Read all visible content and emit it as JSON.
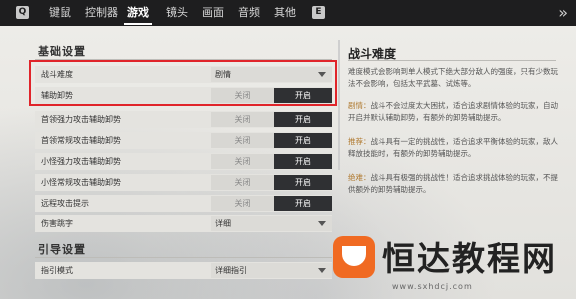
{
  "topbar": {
    "left_icon": "Q",
    "tabs": [
      {
        "label": "键鼠",
        "active": false
      },
      {
        "label": "控制器",
        "active": false
      },
      {
        "label": "游戏",
        "active": true
      },
      {
        "label": "镜头",
        "active": false
      },
      {
        "label": "画面",
        "active": false
      },
      {
        "label": "音频",
        "active": false
      },
      {
        "label": "其他",
        "active": false
      }
    ],
    "right_icon": "E",
    "close_icon": "chevron-right-double-icon"
  },
  "sections": {
    "basic": "基础设置",
    "guide": "引导设置"
  },
  "options": {
    "off": "关闭",
    "on": "开启"
  },
  "rows": {
    "difficulty": {
      "label": "战斗难度",
      "value": "剧情"
    },
    "assist_lock": {
      "label": "辅助卸势"
    },
    "chief_strong": {
      "label": "首领强力攻击辅助卸势"
    },
    "chief_normal": {
      "label": "首领常规攻击辅助卸势"
    },
    "minion_strong": {
      "label": "小怪强力攻击辅助卸势"
    },
    "minion_normal": {
      "label": "小怪常规攻击辅助卸势"
    },
    "ranged_hint": {
      "label": "远程攻击提示"
    },
    "damage_jump": {
      "label": "伤害跳字",
      "value": "详细"
    },
    "guide_mode": {
      "label": "指引模式",
      "value": "详细指引"
    }
  },
  "panel": {
    "title": "战斗难度",
    "intro": "难度模式会影响到单人模式下绝大部分敌人的强度，只有少数玩法不会影响，包括太平武墓、试炼等。",
    "entries": [
      {
        "tag": "剧情：",
        "text": "战斗不会过度太大困扰，适合追求剧情体验的玩家，自动开启并默认辅助卸势，有额外的卸势辅助提示。"
      },
      {
        "tag": "推荐：",
        "text": "战斗具有一定的挑战性，适合追求平衡体验的玩家，敌人释放技能时，有额外的卸势辅助提示。"
      },
      {
        "tag": "绝难：",
        "text": "战斗具有极强的挑战性！适合追求挑战体验的玩家，不提供额外的卸势辅助提示。"
      }
    ]
  },
  "watermark": {
    "text": "恒达教程网",
    "url": "www.sxhdcj.com"
  },
  "colors": {
    "highlight": "#e0242a",
    "active_option": "#2f3033",
    "topbar": "#1e1e1f"
  }
}
